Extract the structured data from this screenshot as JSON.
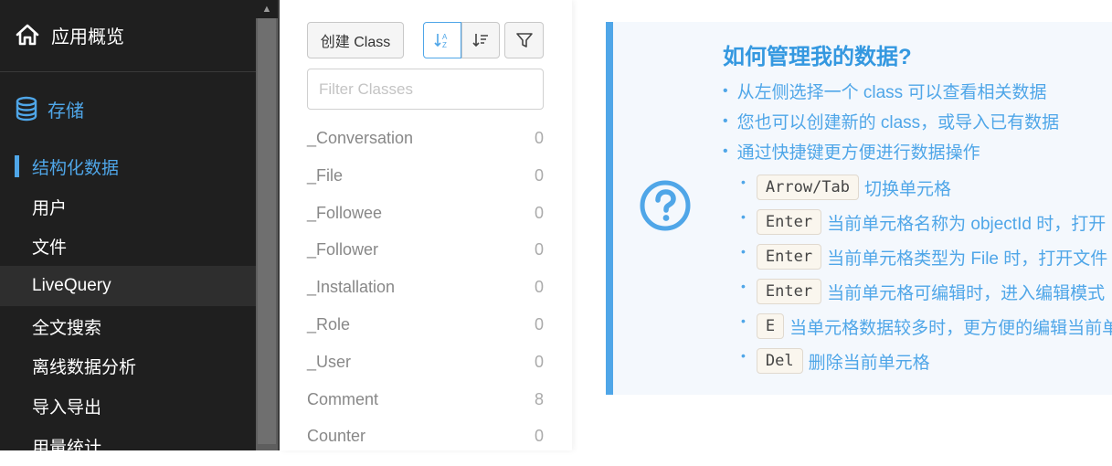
{
  "sidebar": {
    "overview_label": "应用概览",
    "storage_label": "存储",
    "items": [
      {
        "label": "结构化数据"
      },
      {
        "label": "用户"
      },
      {
        "label": "文件"
      },
      {
        "label": "LiveQuery"
      },
      {
        "label": "全文搜索"
      },
      {
        "label": "离线数据分析"
      },
      {
        "label": "导入导出"
      },
      {
        "label": "用量统计"
      }
    ]
  },
  "toolbar": {
    "create_class_label": "创建 Class"
  },
  "filter": {
    "placeholder": "Filter Classes",
    "value": ""
  },
  "classes": [
    {
      "name": "_Conversation",
      "count": "0"
    },
    {
      "name": "_File",
      "count": "0"
    },
    {
      "name": "_Followee",
      "count": "0"
    },
    {
      "name": "_Follower",
      "count": "0"
    },
    {
      "name": "_Installation",
      "count": "0"
    },
    {
      "name": "_Role",
      "count": "0"
    },
    {
      "name": "_User",
      "count": "0"
    },
    {
      "name": "Comment",
      "count": "8"
    },
    {
      "name": "Counter",
      "count": "0"
    }
  ],
  "help": {
    "title": "如何管理我的数据?",
    "items": [
      "从左侧选择一个 class 可以查看相关数据",
      "您也可以创建新的 class，或导入已有数据",
      "通过快捷键更方便进行数据操作"
    ],
    "shortcuts": [
      {
        "key": "Arrow/Tab",
        "desc": "切换单元格"
      },
      {
        "key": "Enter",
        "desc": "当前单元格名称为 objectId 时，打开"
      },
      {
        "key": "Enter",
        "desc": "当前单元格类型为 File 时，打开文件"
      },
      {
        "key": "Enter",
        "desc": "当前单元格可编辑时，进入编辑模式"
      },
      {
        "key": "E",
        "desc": "当单元格数据较多时，更方便的编辑当前单"
      },
      {
        "key": "Del",
        "desc": "删除当前单元格"
      }
    ]
  },
  "colors": {
    "accent": "#4fa6e8",
    "sidebar_bg": "#1f1f1f",
    "help_bg": "#f4f8fd"
  }
}
